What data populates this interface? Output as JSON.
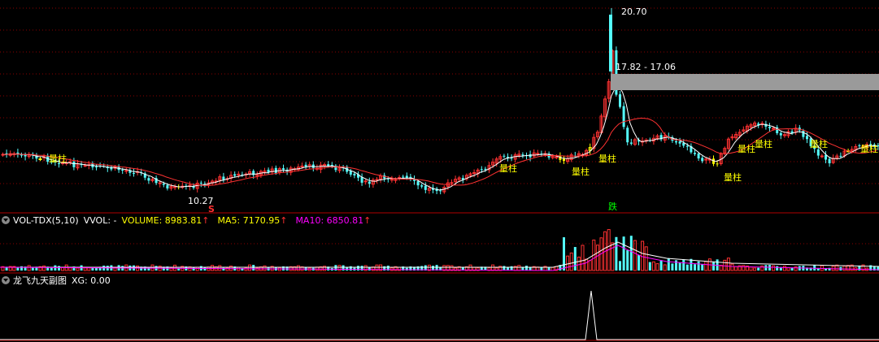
{
  "main": {
    "annotations": {
      "peak": "20.70",
      "zone": "17.82 - 17.06",
      "low": "10.27",
      "sell_marker": "S",
      "drop_marker": "跌",
      "volume_tag": "量柱"
    }
  },
  "vol_panel": {
    "indicator": "VOL-TDX(5,10)",
    "vvol": "VVOL: -",
    "volume": "VOLUME: 8983.81",
    "ma5": "MA5: 7170.95",
    "ma10": "MA10: 6850.81"
  },
  "sub_panel": {
    "name": "龙飞九天副图",
    "xg": "XG: 0.00"
  },
  "colors": {
    "up": "#ff3232",
    "down": "#54fcfc",
    "highlight": "#ffff00",
    "ma_white": "#ffffff",
    "ma_red": "#ff3232",
    "ma_magenta": "#ff00ff",
    "grid": "#8b0000"
  },
  "chart_data": {
    "type": "candlestick",
    "price_annotations": {
      "high": 20.7,
      "zone_top": 17.82,
      "zone_bottom": 17.06,
      "low": 10.27
    },
    "volume_summary": {
      "volume": 8983.81,
      "ma5": 7170.95,
      "ma10": 6850.81
    },
    "xg_value": 0.0
  }
}
